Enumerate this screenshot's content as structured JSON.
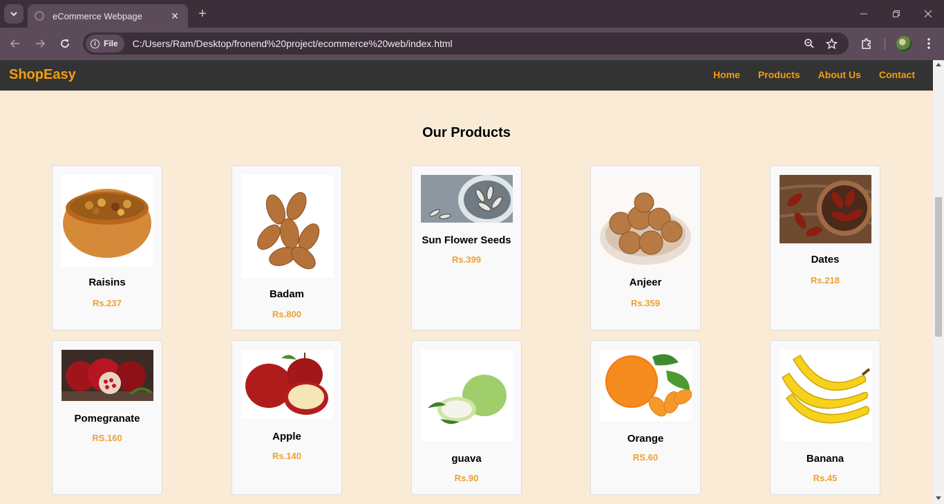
{
  "browser": {
    "tab_title": "eCommerce Webpage",
    "file_chip": "File",
    "url": "C:/Users/Ram/Desktop/fronend%20project/ecommerce%20web/index.html"
  },
  "site": {
    "brand": "ShopEasy",
    "nav": [
      "Home",
      "Products",
      "About Us",
      "Contact"
    ],
    "section_title": "Our Products",
    "accent_color": "#f59e0b",
    "page_background": "#faebd7"
  },
  "products": [
    {
      "name": "Raisins",
      "price": "Rs.237"
    },
    {
      "name": "Badam",
      "price": "Rs.800"
    },
    {
      "name": "Sun Flower Seeds",
      "price": "Rs.399"
    },
    {
      "name": "Anjeer",
      "price": "Rs.359"
    },
    {
      "name": "Dates",
      "price": "Rs.218"
    },
    {
      "name": "Pomegranate",
      "price": "RS.160"
    },
    {
      "name": "Apple",
      "price": "Rs.140"
    },
    {
      "name": "guava",
      "price": "Rs.90"
    },
    {
      "name": "Orange",
      "price": "RS.60"
    },
    {
      "name": "Banana",
      "price": "Rs.45"
    }
  ]
}
